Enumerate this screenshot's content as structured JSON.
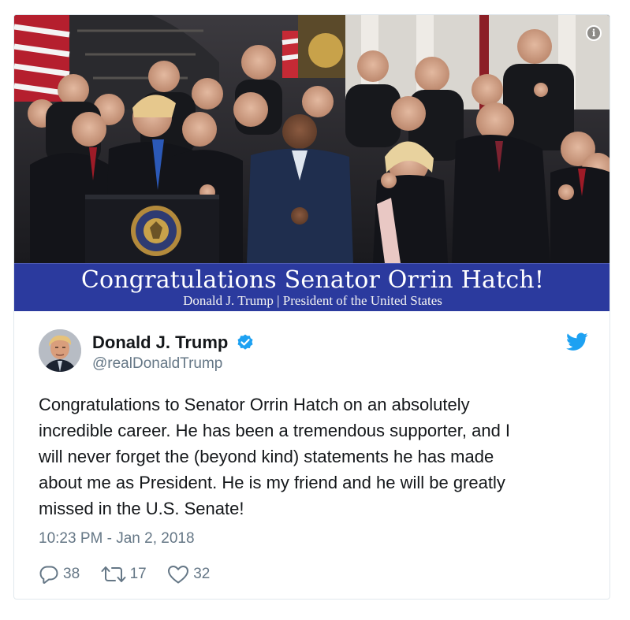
{
  "media": {
    "banner_title": "Congratulations Senator Orrin Hatch!",
    "banner_subtitle": "Donald J. Trump | President of the United States",
    "banner_color": "#2b3a9e",
    "info_icon": "info-icon"
  },
  "author": {
    "display_name": "Donald J. Trump",
    "handle": "@realDonaldTrump",
    "verified_color": "#1da1f2"
  },
  "tweet": {
    "text": "Congratulations to Senator Orrin Hatch on an absolutely\nincredible career. He has been a tremendous supporter, and I\nwill never forget the (beyond kind) statements he has made\nabout me as President. He is my friend and he will be greatly\nmissed in the U.S. Senate!",
    "timestamp": "10:23 PM - Jan 2, 2018"
  },
  "actions": {
    "replies": "38",
    "retweets": "17",
    "likes": "32"
  },
  "colors": {
    "text": "#14171a",
    "secondary": "#657786",
    "twitter_blue": "#1da1f2",
    "border": "#e1e8ed"
  }
}
